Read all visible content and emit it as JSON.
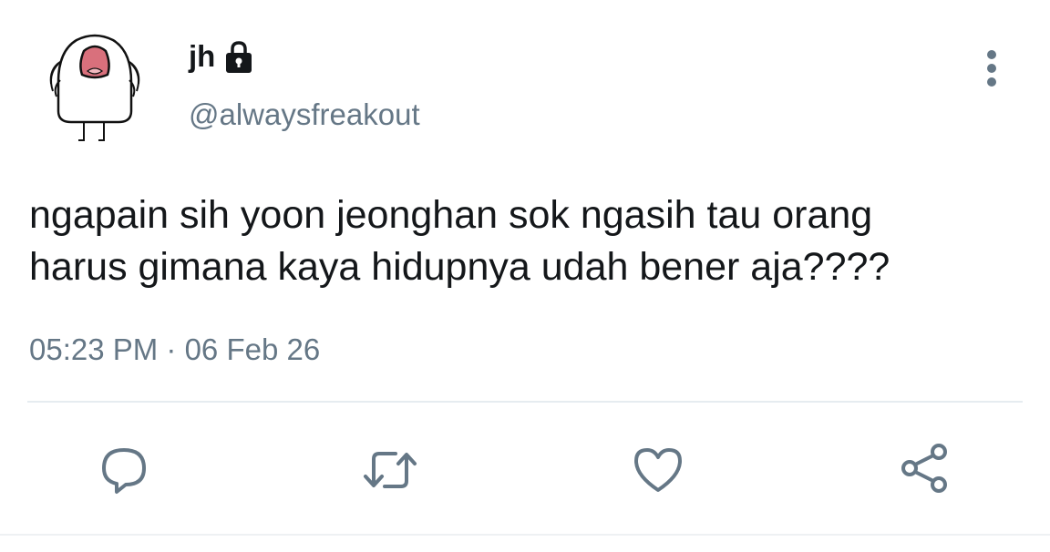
{
  "author": {
    "display_name": "jh",
    "handle": "@alwaysfreakout",
    "protected_icon": "lock-icon",
    "avatar_icon": "screaming-doodle-avatar"
  },
  "tweet": {
    "text": "ngapain sih yoon jeonghan sok ngasih tau orang\nharus gimana kaya hidupnya udah bener aja????",
    "time": "05:23 PM",
    "separator": " · ",
    "date": "06 Feb 26"
  },
  "actions": [
    {
      "name": "reply",
      "icon": "reply-icon"
    },
    {
      "name": "retweet",
      "icon": "retweet-icon"
    },
    {
      "name": "like",
      "icon": "heart-icon"
    },
    {
      "name": "share",
      "icon": "share-icon"
    }
  ],
  "colors": {
    "text": "#14171a",
    "secondary": "#657786",
    "divider": "#e6ecf0",
    "avatar_mouth": "#d9707c"
  }
}
